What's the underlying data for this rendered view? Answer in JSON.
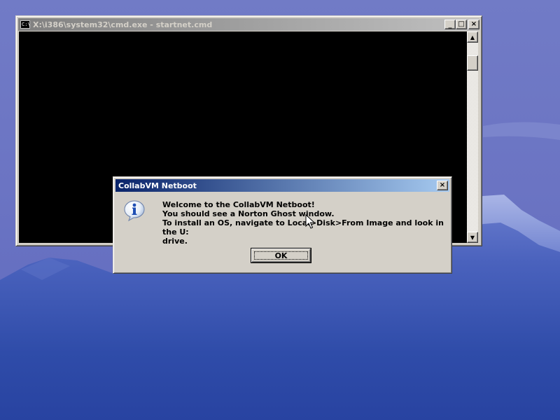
{
  "console_window": {
    "title": "X:\\i386\\system32\\cmd.exe - startnet.cmd",
    "icon": "console-icon",
    "icon_glyph": "C:\\",
    "buttons": {
      "minimize": "_",
      "maximize": "□",
      "close": "×"
    },
    "scroll_up": "▲",
    "scroll_down": "▼"
  },
  "dialog": {
    "title": "CollabVM Netboot",
    "close": "×",
    "icon": "info-icon",
    "lines": [
      "Welcome to the CollabVM Netboot!",
      "You should see a Norton Ghost window.",
      "To install an OS, navigate to Local>Disk>From Image and look in the U:",
      "drive."
    ],
    "ok_label": "OK"
  },
  "colors": {
    "active_title": "#0a246a",
    "inactive_title": "#808080",
    "window_face": "#d4d0c8",
    "console_bg": "#000000"
  }
}
